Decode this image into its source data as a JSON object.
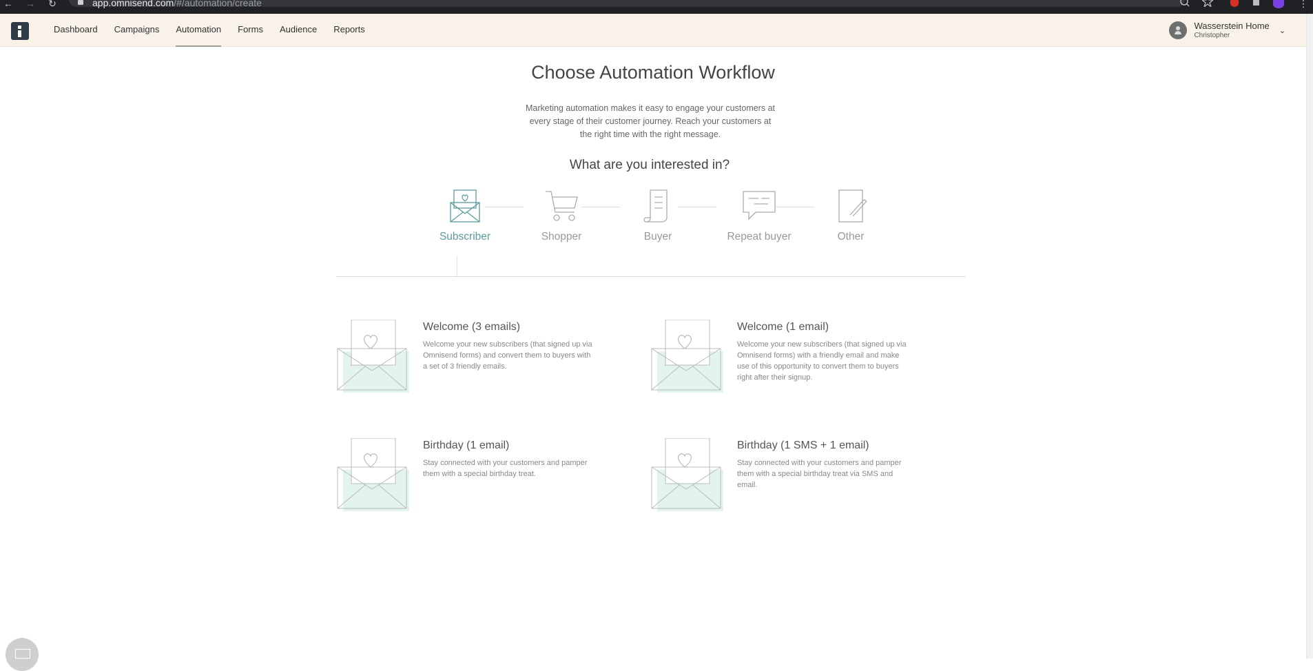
{
  "browser": {
    "url_host": "app.omnisend.com",
    "url_path": "/#/automation/create"
  },
  "header": {
    "nav": [
      {
        "label": "Dashboard",
        "active": false
      },
      {
        "label": "Campaigns",
        "active": false
      },
      {
        "label": "Automation",
        "active": true
      },
      {
        "label": "Forms",
        "active": false
      },
      {
        "label": "Audience",
        "active": false
      },
      {
        "label": "Reports",
        "active": false
      }
    ],
    "user": {
      "name": "Wasserstein Home",
      "sub": "Christopher"
    }
  },
  "page": {
    "title": "Choose Automation Workflow",
    "intro": "Marketing automation makes it easy to engage your customers at every stage of their customer journey. Reach your customers at the right time with the right message.",
    "question": "What are you interested in?"
  },
  "steps": [
    {
      "label": "Subscriber",
      "icon": "envelope-heart-icon",
      "active": true
    },
    {
      "label": "Shopper",
      "icon": "cart-icon",
      "active": false
    },
    {
      "label": "Buyer",
      "icon": "receipt-icon",
      "active": false
    },
    {
      "label": "Repeat buyer",
      "icon": "chat-icon",
      "active": false
    },
    {
      "label": "Other",
      "icon": "note-pencil-icon",
      "active": false
    }
  ],
  "workflows": [
    {
      "title": "Welcome (3 emails)",
      "desc": "Welcome your new subscribers (that signed up via Omnisend forms) and convert them to buyers with a set of 3 friendly emails."
    },
    {
      "title": "Welcome (1 email)",
      "desc": "Welcome your new subscribers (that signed up via Omnisend forms) with a friendly email and make use of this opportunity to convert them to buyers right after their signup."
    },
    {
      "title": "Birthday (1 email)",
      "desc": "Stay connected with your customers and pamper them with a special birthday treat."
    },
    {
      "title": "Birthday (1 SMS + 1 email)",
      "desc": "Stay connected with your customers and pamper them with a special birthday treat via SMS and email."
    }
  ],
  "colors": {
    "accent": "#5d9a9a",
    "header_bg": "#f8f2e9",
    "thumb_fill": "#e3f3ee"
  }
}
